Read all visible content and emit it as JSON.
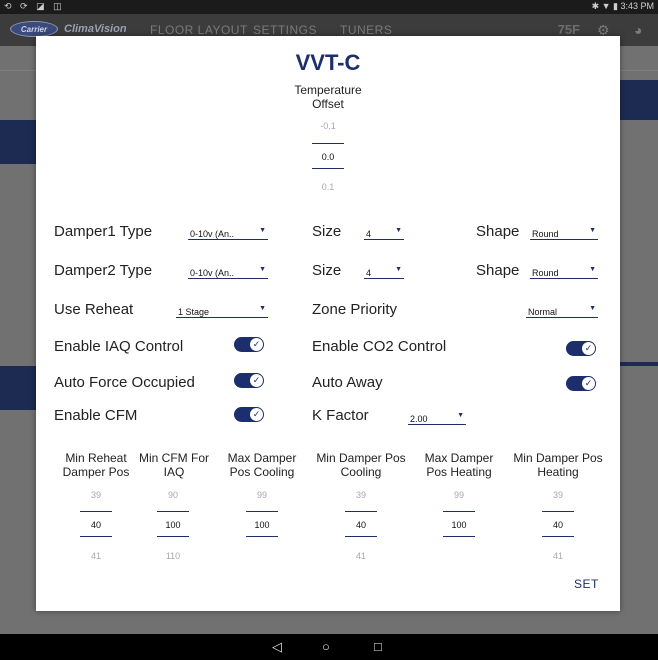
{
  "status_bar": {
    "left_icons": "⟲ ⟳ ◪ ◫",
    "right_text": "✱ ▼ ▮ 3:43 PM"
  },
  "app_header": {
    "logo": "Carrier",
    "brand": "ClimaVision",
    "nav": [
      "FLOOR LAYOUT",
      "SETTINGS",
      "TUNERS"
    ],
    "temp_badge": "75F"
  },
  "dialog": {
    "title": "VVT-C",
    "temperature_offset": {
      "label": "Temperature Offset",
      "prev": "-0.1",
      "value": "0.0",
      "next": "0.1"
    },
    "damper1": {
      "label": "Damper1 Type",
      "type": "0-10v (An..",
      "size_label": "Size",
      "size": "4",
      "shape_label": "Shape",
      "shape": "Round"
    },
    "damper2": {
      "label": "Damper2 Type",
      "type": "0-10v (An..",
      "size_label": "Size",
      "size": "4",
      "shape_label": "Shape",
      "shape": "Round"
    },
    "reheat": {
      "label": "Use Reheat",
      "value": "1 Stage"
    },
    "zone_priority": {
      "label": "Zone Priority",
      "value": "Normal"
    },
    "toggles": {
      "iaq": {
        "label": "Enable IAQ Control",
        "on": true
      },
      "co2": {
        "label": "Enable CO2 Control",
        "on": true
      },
      "auto_force": {
        "label": "Auto Force Occupied",
        "on": true
      },
      "auto_away": {
        "label": "Auto Away",
        "on": true
      },
      "cfm": {
        "label": "Enable CFM",
        "on": true
      }
    },
    "k_factor": {
      "label": "K Factor",
      "value": "2.00"
    },
    "columns": [
      {
        "label": "Min Reheat Damper Pos",
        "prev": "39",
        "value": "40",
        "next": "41"
      },
      {
        "label": "Min CFM For IAQ",
        "prev": "90",
        "value": "100",
        "next": "110"
      },
      {
        "label": "Max Damper Pos Cooling",
        "prev": "99",
        "value": "100",
        "next": ""
      },
      {
        "label": "Min Damper Pos Cooling",
        "prev": "39",
        "value": "40",
        "next": "41"
      },
      {
        "label": "Max Damper Pos Heating",
        "prev": "99",
        "value": "100",
        "next": ""
      },
      {
        "label": "Min Damper Pos Heating",
        "prev": "39",
        "value": "40",
        "next": "41"
      }
    ],
    "set_label": "SET"
  },
  "nav_bar": {
    "back": "◁",
    "home": "○",
    "recents": "□"
  }
}
